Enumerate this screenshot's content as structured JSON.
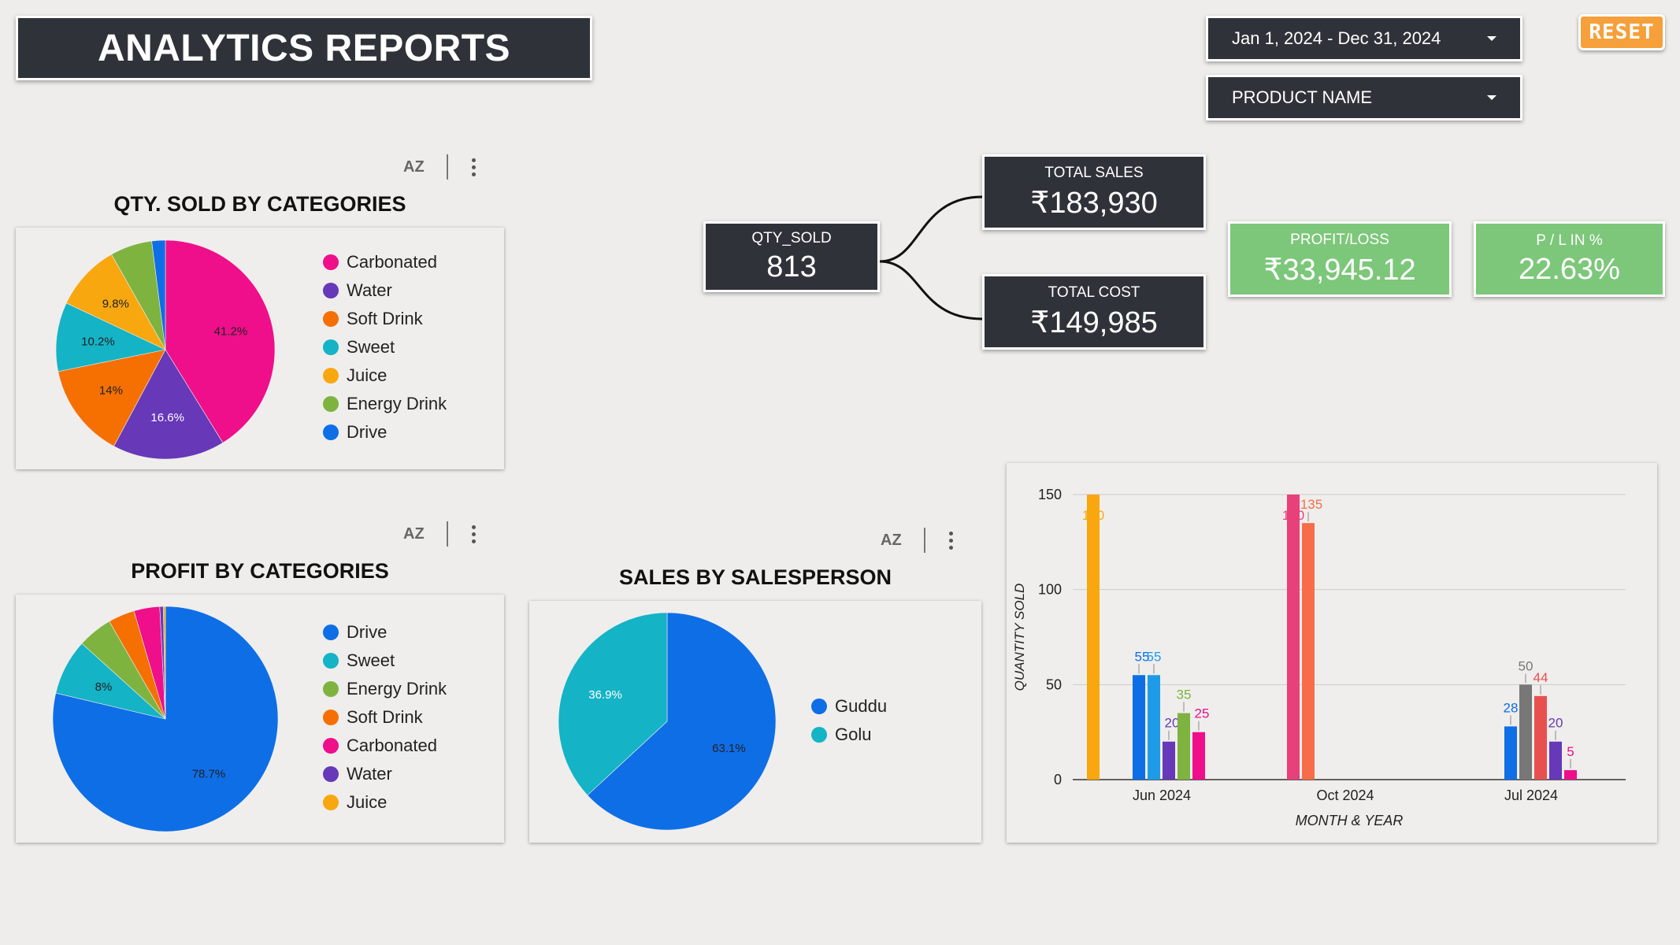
{
  "header": {
    "title": "ANALYTICS REPORTS"
  },
  "filters": {
    "date_range": "Jan 1, 2024 - Dec 31, 2024",
    "product": "PRODUCT NAME",
    "reset_label": "RESET"
  },
  "kpis": {
    "qty_sold": {
      "label": "QTY_SOLD",
      "value": "813"
    },
    "total_sales": {
      "label": "TOTAL SALES",
      "value": "₹183,930"
    },
    "total_cost": {
      "label": "TOTAL COST",
      "value": "₹149,985"
    },
    "profit_loss": {
      "label": "PROFIT/LOSS",
      "value": "₹33,945.12"
    },
    "pl_percent": {
      "label": "P / L IN %",
      "value": "22.63%"
    }
  },
  "toolbar": {
    "sort_icon_text": "AZ"
  },
  "colors": {
    "Carbonated": "#ef0f8a",
    "Water": "#6738b8",
    "Soft Drink": "#f57000",
    "Sweet": "#14b3c5",
    "Juice": "#f9a70f",
    "Energy Drink": "#7eb340",
    "Drive": "#0e6ee6",
    "Guddu": "#0e6ee6",
    "Golu": "#14b3c5"
  },
  "charts": {
    "qty_by_cat": {
      "title": "QTY. SOLD BY CATEGORIES"
    },
    "profit_by_cat": {
      "title": "PROFIT BY CATEGORIES"
    },
    "sales_by_person": {
      "title": "SALES BY SALESPERSON"
    },
    "qty_by_month": {
      "xlabel": "MONTH & YEAR",
      "ylabel": "QUANTITY SOLD"
    }
  },
  "chart_data": [
    {
      "id": "qty_by_cat",
      "type": "pie",
      "title": "QTY. SOLD BY CATEGORIES",
      "legend_position": "right",
      "slices": [
        {
          "label": "Carbonated",
          "value": 41.2,
          "text": "41.2%"
        },
        {
          "label": "Water",
          "value": 16.6,
          "text": "16.6%"
        },
        {
          "label": "Soft Drink",
          "value": 14.0,
          "text": "14%"
        },
        {
          "label": "Sweet",
          "value": 10.2,
          "text": "10.2%"
        },
        {
          "label": "Juice",
          "value": 9.8,
          "text": "9.8%"
        },
        {
          "label": "Energy Drink",
          "value": 6.2,
          "text": ""
        },
        {
          "label": "Drive",
          "value": 2.0,
          "text": ""
        }
      ]
    },
    {
      "id": "profit_by_cat",
      "type": "pie",
      "title": "PROFIT BY CATEGORIES",
      "legend_position": "right",
      "slices": [
        {
          "label": "Drive",
          "value": 78.7,
          "text": "78.7%"
        },
        {
          "label": "Sweet",
          "value": 8.0,
          "text": "8%"
        },
        {
          "label": "Energy Drink",
          "value": 5.0,
          "text": ""
        },
        {
          "label": "Soft Drink",
          "value": 3.8,
          "text": ""
        },
        {
          "label": "Carbonated",
          "value": 3.7,
          "text": ""
        },
        {
          "label": "Water",
          "value": 0.5,
          "text": ""
        },
        {
          "label": "Juice",
          "value": 0.3,
          "text": ""
        }
      ]
    },
    {
      "id": "sales_by_person",
      "type": "pie",
      "title": "SALES BY SALESPERSON",
      "legend_position": "right",
      "slices": [
        {
          "label": "Guddu",
          "value": 63.1,
          "text": "63.1%"
        },
        {
          "label": "Golu",
          "value": 36.9,
          "text": "36.9%"
        }
      ]
    },
    {
      "id": "qty_by_month",
      "type": "bar",
      "xlabel": "MONTH & YEAR",
      "ylabel": "QUANTITY SOLD",
      "ylim": [
        0,
        150
      ],
      "yticks": [
        0,
        50,
        100,
        150
      ],
      "grid": true,
      "groups": [
        {
          "label": "Jun 2024",
          "bars": [
            {
              "value": 150,
              "color": "#f9a70f",
              "label": "150"
            },
            {
              "value": 55,
              "color": "#0e6ee6",
              "label": "55"
            },
            {
              "value": 55,
              "color": "#1e9be8",
              "label": "55"
            },
            {
              "value": 20,
              "color": "#6738b8",
              "label": "20"
            },
            {
              "value": 35,
              "color": "#7eb340",
              "label": "35"
            },
            {
              "value": 25,
              "color": "#ef0f8a",
              "label": "25"
            }
          ]
        },
        {
          "label": "Oct 2024",
          "bars": [
            {
              "value": 150,
              "color": "#e8407a",
              "label": "150"
            },
            {
              "value": 135,
              "color": "#f76d4a",
              "label": "135"
            }
          ]
        },
        {
          "label": "Jul 2024",
          "bars": [
            {
              "value": 28,
              "color": "#0e6ee6",
              "label": "28"
            },
            {
              "value": 50,
              "color": "#777777",
              "label": "50"
            },
            {
              "value": 44,
              "color": "#e85050",
              "label": "44"
            },
            {
              "value": 20,
              "color": "#6738b8",
              "label": "20"
            },
            {
              "value": 5,
              "color": "#ef0f8a",
              "label": "5"
            }
          ]
        }
      ]
    }
  ]
}
